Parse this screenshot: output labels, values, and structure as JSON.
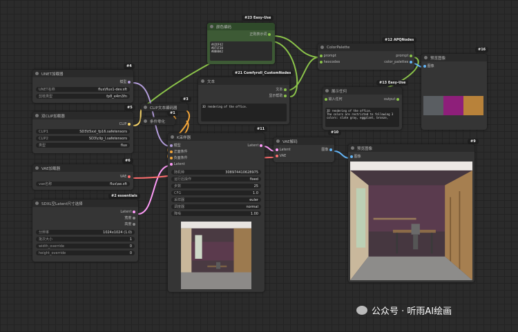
{
  "nodes": {
    "easyuse_color": {
      "badge": "#23 Easy-Use",
      "title": "颜色编码",
      "output": "正则表示词",
      "text": "#42DF42\n#871F38\n#BB8B42"
    },
    "colorpalette": {
      "badge": "#12 APQNodes",
      "title": "ColorPalette",
      "in1": "prompt",
      "in2": "hexcodes",
      "out1": "prompt",
      "out2": "color_palettes"
    },
    "preview1": {
      "badge": "#16",
      "title": "预览图像",
      "in1": "图像",
      "swatches": [
        "#5a5e62",
        "#8e1f7a",
        "#b8823a"
      ]
    },
    "text_node": {
      "badge": "#21 Comfyroll_CustomNodes",
      "title": "文本",
      "out1": "文本",
      "out2": "显示帮助",
      "text": "3D rendering of the office."
    },
    "unet": {
      "badge": "#4",
      "title": "UNET加载器",
      "out1": "模型",
      "w1l": "UNET名称",
      "w1v": "flux\\flux1-dev.sft",
      "w2l": "剪枝类型",
      "w2v": "fp8_e4m3fn"
    },
    "showany": {
      "badge": "#13 Easy-Use",
      "title": "展示任何",
      "in1": "输入任何",
      "out1": "output",
      "text": "3D rendering of the office.\nThe colors are restricted to following 3\ncolors: slate gray, eggplant, bronze,"
    },
    "dualclip": {
      "badge": "#5",
      "title": "双CLIP加载器",
      "out1": "CLIP",
      "w1l": "CLIP1",
      "w1v": "SD3\\t5xxl_fp16.safetensors",
      "w2l": "CLIP2",
      "w2v": "SD3\\clip_l.safetensors",
      "w3l": "类型",
      "w3v": "flux"
    },
    "clipenc": {
      "badge": "#3",
      "title": "CLIP文本编码器",
      "title2": "条件零化",
      "mini": "#1"
    },
    "ksampler": {
      "badge": "#11",
      "title": "K采样器",
      "in1": "模型",
      "in2": "正面条件",
      "in3": "负面条件",
      "in4": "Latent",
      "out1": "Latent",
      "widgets": [
        [
          "随机种",
          "308974410628975"
        ],
        [
          "运行后操作",
          "fixed"
        ],
        [
          "步数",
          "25"
        ],
        [
          "CFG",
          "1.0"
        ],
        [
          "采样器",
          "euler"
        ],
        [
          "调度器",
          "normal"
        ],
        [
          "降噪",
          "1.00"
        ]
      ]
    },
    "vaedecode": {
      "badge": "#10",
      "title": "VAE解码",
      "in1": "Latent",
      "in2": "VAE",
      "out1": "图像"
    },
    "vaeloader": {
      "badge": "#6",
      "title": "VAE加载器",
      "out1": "VAE",
      "w1l": "vae名称",
      "w1v": "flux\\ae.sft"
    },
    "preview2": {
      "badge": "#9",
      "title": "预览图像",
      "in1": "图像"
    },
    "sdxl": {
      "badge": "#2 essentials",
      "title": "SDXL空Latent尺寸选择",
      "out1": "Latent",
      "out2": "宽度",
      "out3": "高度",
      "widgets": [
        [
          "分辨率",
          "1024x1024 (1.0)"
        ],
        [
          "批次大小",
          "1"
        ],
        [
          "width_override",
          "0"
        ],
        [
          "height_override",
          "0"
        ]
      ]
    }
  },
  "watermark": "公众号 · 听雨AI绘画",
  "colors": {
    "model": "#b39ddb",
    "clip": "#f7d56a",
    "cond": "#f4a63a",
    "latent": "#ff9cf9",
    "vae": "#ff6e6e",
    "image": "#64b5f6",
    "string": "#8bc34a"
  }
}
